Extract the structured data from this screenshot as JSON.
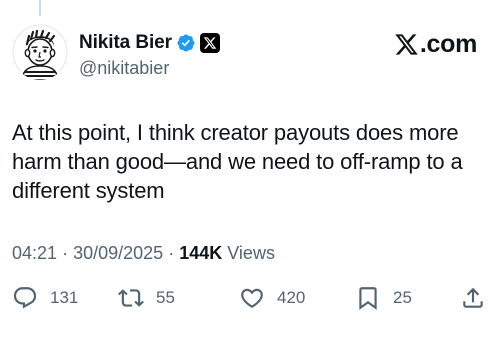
{
  "author": {
    "display_name": "Nikita Bier",
    "handle": "@nikitabier"
  },
  "brand": {
    "label": ".com"
  },
  "tweet": {
    "lines": [
      "At this point, I think creator payouts does more",
      "harm than good—and we need to off-ramp to a",
      "different system"
    ]
  },
  "meta": {
    "time": "04:21",
    "separator_1": "·",
    "date": "30/09/2025",
    "separator_2": "·",
    "views_count": "144K",
    "views_label": "Views"
  },
  "actions": {
    "replies": "131",
    "retweets": "55",
    "likes": "420",
    "bookmarks": "25"
  },
  "icons": {
    "verified": "verified-badge-icon",
    "affiliate": "x-logo-icon",
    "reply": "reply-icon",
    "retweet": "retweet-icon",
    "like": "heart-icon",
    "bookmark": "bookmark-icon",
    "share": "share-icon"
  },
  "colors": {
    "verified_blue": "#1d9bf0",
    "secondary_text": "#536471",
    "primary_text": "#0f1419"
  }
}
